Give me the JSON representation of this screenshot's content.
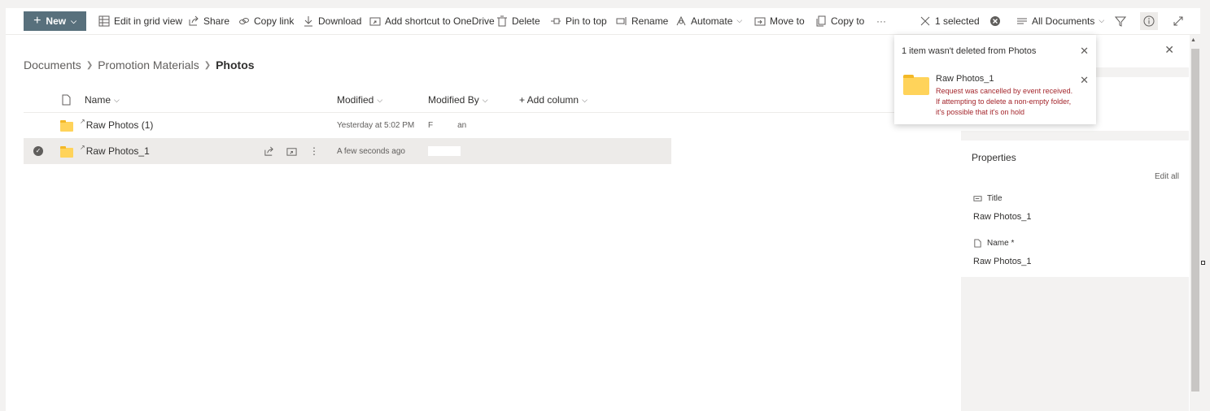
{
  "toolbar": {
    "new_label": "New",
    "edit_grid_label": "Edit in grid view",
    "share_label": "Share",
    "copy_link_label": "Copy link",
    "download_label": "Download",
    "add_shortcut_label": "Add shortcut to OneDrive",
    "delete_label": "Delete",
    "pin_label": "Pin to top",
    "rename_label": "Rename",
    "automate_label": "Automate",
    "move_label": "Move to",
    "copy_to_label": "Copy to",
    "more_label": "···",
    "selected_label": "1 selected",
    "view_label": "All Documents"
  },
  "breadcrumb": {
    "item1": "Documents",
    "item2": "Promotion Materials",
    "current": "Photos"
  },
  "list": {
    "columns": {
      "name": "Name",
      "modified": "Modified",
      "modified_by": "Modified By",
      "add_column": "+ Add column"
    },
    "rows": [
      {
        "name": "Raw Photos (1)",
        "modified": "Yesterday at 5:02 PM",
        "modified_by_a": "F",
        "modified_by_b": "an"
      },
      {
        "name": "Raw Photos_1",
        "modified": "A few seconds ago",
        "modified_by_a": "",
        "modified_by_b": ""
      }
    ]
  },
  "details": {
    "properties_title": "Properties",
    "edit_all": "Edit all",
    "title_label": "Title",
    "title_value": "Raw Photos_1",
    "name_label": "Name *",
    "name_value": "Raw Photos_1"
  },
  "toast": {
    "title": "1 item wasn't deleted from Photos",
    "item_name": "Raw Photos_1",
    "error": "Request was cancelled by event received. If attempting to delete a non-empty folder, it's possible that it's on hold"
  },
  "colors": {
    "accent": "#58707c",
    "error": "#a4262c",
    "folder": "#ffd35a",
    "selection": "#edebe9"
  },
  "icons": [
    "plus-icon",
    "grid-icon",
    "share-icon",
    "link-icon",
    "download-icon",
    "shortcut-icon",
    "trash-icon",
    "pin-icon",
    "rename-icon",
    "automate-icon",
    "move-icon",
    "copy-icon",
    "close-icon",
    "clear-circle-icon",
    "view-icon",
    "filter-icon",
    "info-icon",
    "expand-icon",
    "file-icon",
    "folder-icon",
    "checkmark-icon",
    "kebab-icon"
  ]
}
